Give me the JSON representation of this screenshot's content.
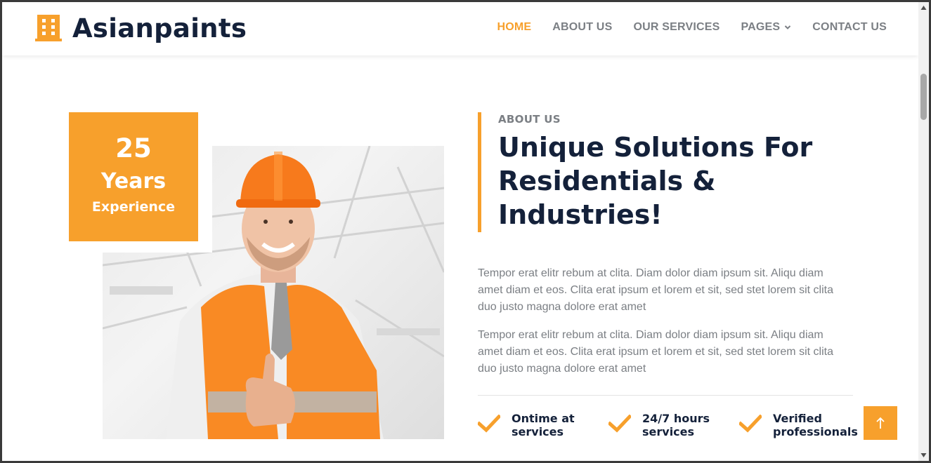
{
  "brand": {
    "name": "Asianpaints",
    "icon": "building-icon",
    "color": "#f7a02c"
  },
  "nav": {
    "items": [
      {
        "label": "HOME",
        "active": true
      },
      {
        "label": "ABOUT US",
        "active": false
      },
      {
        "label": "OUR SERVICES",
        "active": false
      },
      {
        "label": "PAGES",
        "active": false,
        "dropdown": true
      },
      {
        "label": "CONTACT US",
        "active": false
      }
    ]
  },
  "experience": {
    "number": "25",
    "unit": "Years",
    "label": "Experience"
  },
  "about": {
    "kicker": "ABOUT US",
    "title": "Unique Solutions For Residentials & Industries!",
    "paragraphs": [
      "Tempor erat elitr rebum at clita. Diam dolor diam ipsum sit. Aliqu diam amet diam et eos. Clita erat ipsum et lorem et sit, sed stet lorem sit clita duo justo magna dolore erat amet",
      "Tempor erat elitr rebum at clita. Diam dolor diam ipsum sit. Aliqu diam amet diam et eos. Clita erat ipsum et lorem et sit, sed stet lorem sit clita duo justo magna dolore erat amet"
    ],
    "features": [
      {
        "label": "Ontime at\nservices",
        "icon": "check-icon"
      },
      {
        "label": "24/7 hours\nservices",
        "icon": "check-icon"
      },
      {
        "label": "Verified\nprofessionals",
        "icon": "check-icon"
      }
    ]
  },
  "photo": {
    "description_icon": "worker-photo"
  },
  "back_to_top": {
    "icon": "arrow-up-icon"
  },
  "colors": {
    "accent": "#f7a02c",
    "heading": "#14213a",
    "body_text": "#7b7f84"
  }
}
